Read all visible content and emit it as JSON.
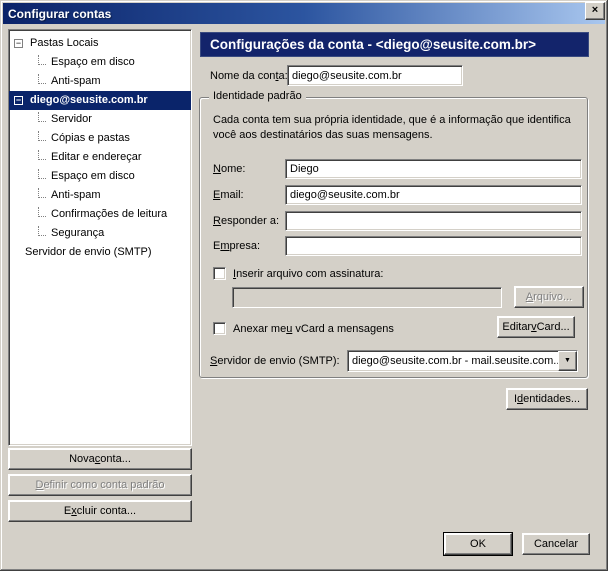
{
  "window": {
    "title": "Configurar contas"
  },
  "icons": {
    "close": "×",
    "collapse": "−",
    "dropdown": "▼"
  },
  "tree": {
    "items": [
      {
        "label": "Pastas Locais"
      },
      {
        "label": "Espaço em disco"
      },
      {
        "label": "Anti-spam"
      },
      {
        "label": "diego@seusite.com.br"
      },
      {
        "label": "Servidor"
      },
      {
        "label": "Cópias e pastas"
      },
      {
        "label": "Editar e endereçar"
      },
      {
        "label": "Espaço em disco"
      },
      {
        "label": "Anti-spam"
      },
      {
        "label": "Confirmações de leitura"
      },
      {
        "label": "Segurança"
      },
      {
        "label": "Servidor de envio (SMTP)"
      }
    ]
  },
  "left_buttons": {
    "new_account": {
      "text": "Nova conta...",
      "u": 5
    },
    "set_default": {
      "text": "Definir como conta padrão",
      "u": 0,
      "disabled": true
    },
    "delete_account": {
      "text": "Excluir conta...",
      "u": 1
    }
  },
  "main": {
    "header": "Configurações da conta - <diego@seusite.com.br>",
    "account_name": {
      "label": {
        "text": "Nome da conta:",
        "u": 11
      },
      "value": "diego@seusite.com.br"
    },
    "identity": {
      "legend": "Identidade padrão",
      "description": "Cada conta tem sua própria identidade, que é a informação que identifica você aos destinatários das suas mensagens.",
      "fields": {
        "name": {
          "label": {
            "text": "Nome:",
            "u": 0
          },
          "value": "Diego"
        },
        "email": {
          "label": {
            "text": "Email:",
            "u": 0
          },
          "value": "diego@seusite.com.br"
        },
        "reply_to": {
          "label": {
            "text": "Responder a:",
            "u": 0
          },
          "value": ""
        },
        "organization": {
          "label": {
            "text": "Empresa:",
            "u": 1
          },
          "value": ""
        }
      },
      "signature": {
        "checkbox_label": {
          "text": "Inserir arquivo com assinatura:",
          "u": 0
        },
        "checked": false,
        "path_value": "",
        "browse_button": {
          "text": "Arquivo...",
          "u": 0,
          "disabled": true
        }
      },
      "vcard": {
        "checkbox_label": {
          "text": "Anexar meu vCard a mensagens",
          "u": 9
        },
        "checked": false,
        "edit_button": {
          "text": "Editar vCard...",
          "u": 7
        }
      },
      "smtp": {
        "label": {
          "text": "Servidor de envio (SMTP):",
          "u": 0
        },
        "value": "diego@seusite.com.br - mail.seusite.com..."
      }
    },
    "identities_button": {
      "text": "Identidades...",
      "u": 1
    }
  },
  "footer": {
    "ok": "OK",
    "cancel": "Cancelar"
  }
}
